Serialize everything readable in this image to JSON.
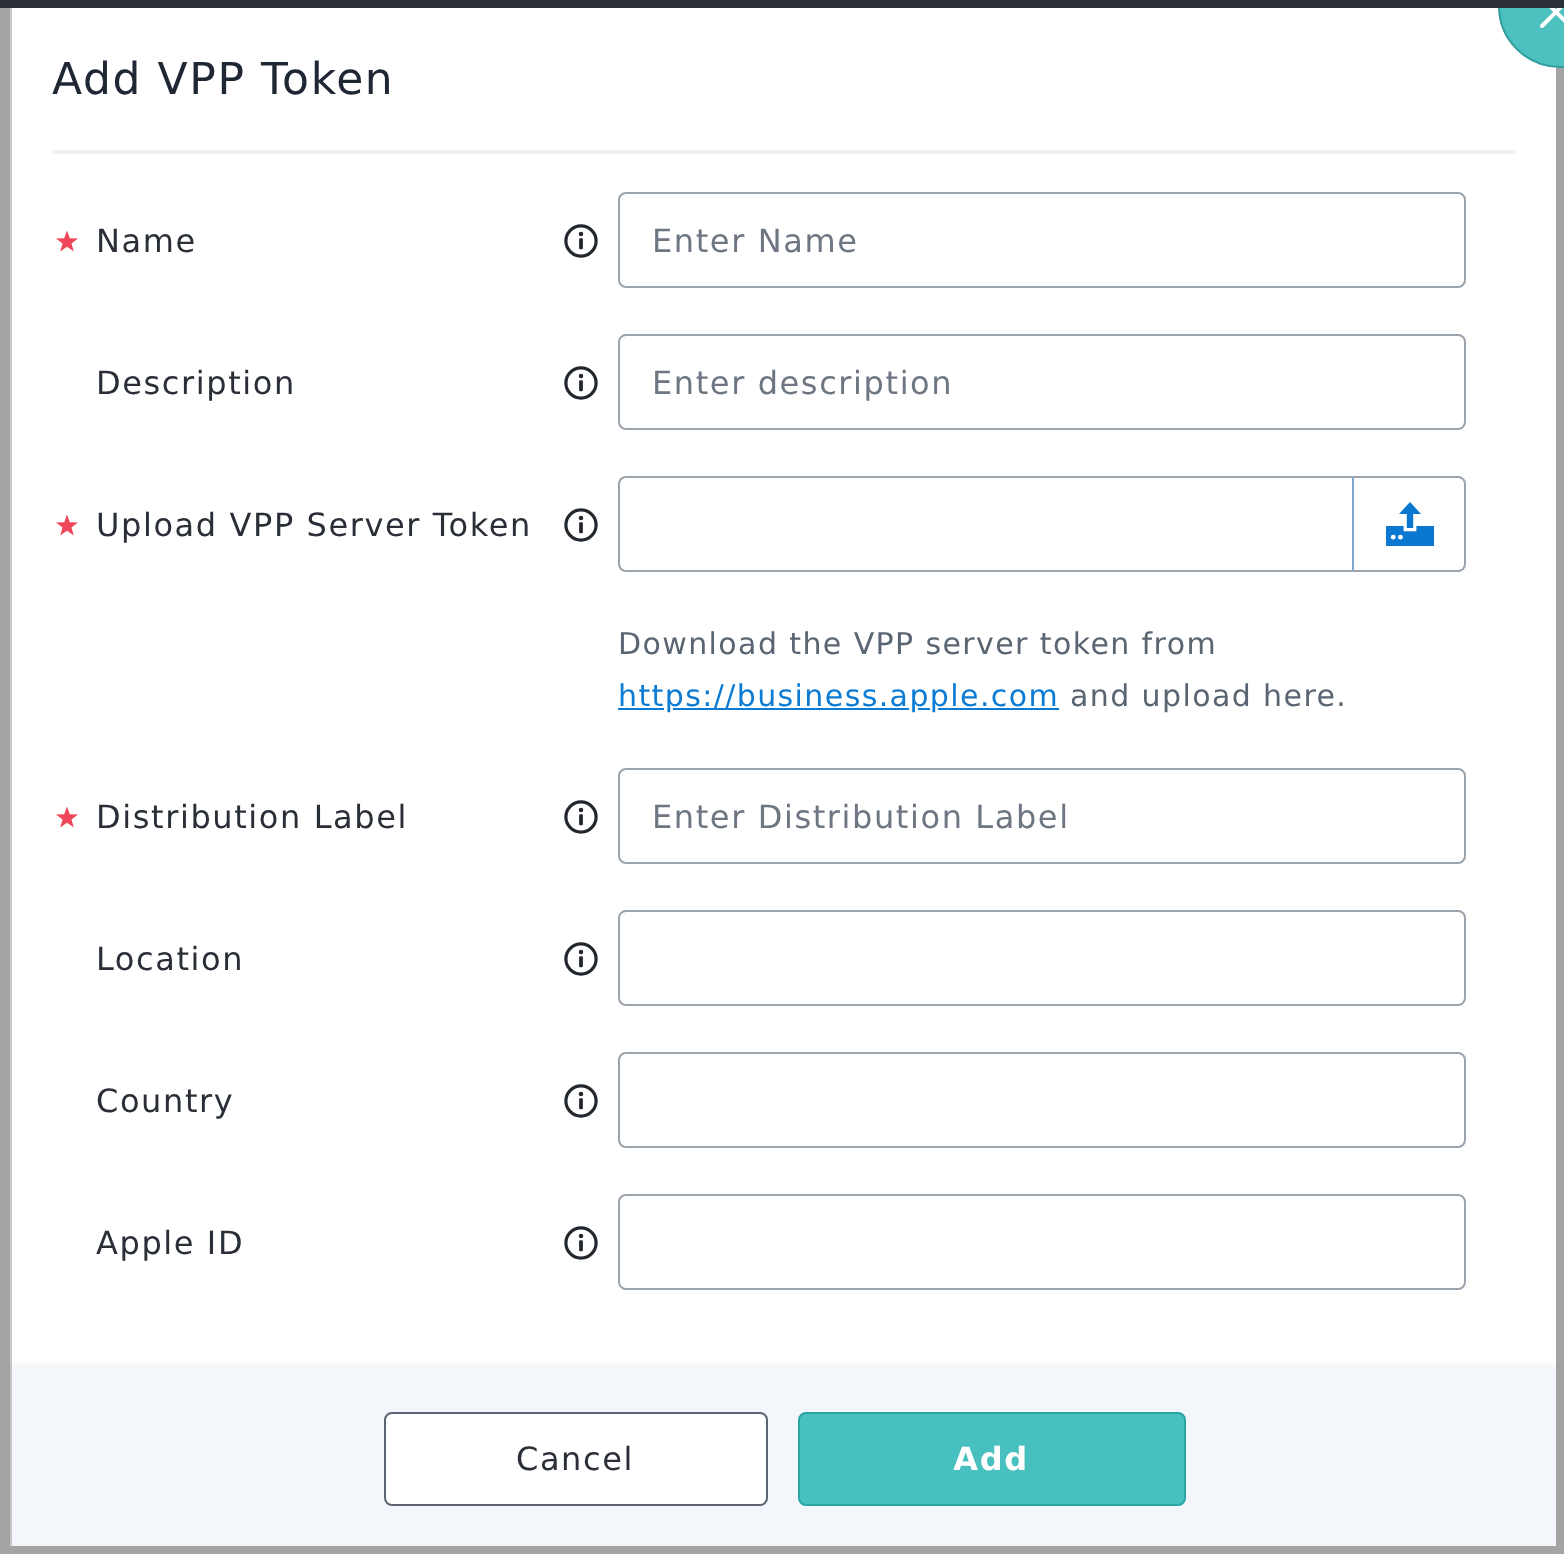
{
  "dialog": {
    "title": "Add VPP Token"
  },
  "fields": [
    {
      "label": "Name",
      "required": true,
      "kind": "text",
      "placeholder": "Enter Name"
    },
    {
      "label": "Description",
      "required": false,
      "kind": "text",
      "placeholder": "Enter description"
    },
    {
      "label": "Upload VPP Server Token",
      "required": true,
      "kind": "file",
      "help": {
        "text_before": "Download the VPP server token from",
        "link": "https://business.apple.com",
        "text_after": "and upload here."
      }
    },
    {
      "label": "Distribution Label",
      "required": true,
      "kind": "text",
      "placeholder": "Enter Distribution Label"
    },
    {
      "label": "Location",
      "required": false,
      "kind": "text"
    },
    {
      "label": "Country",
      "required": false,
      "kind": "text"
    },
    {
      "label": "Apple ID",
      "required": false,
      "kind": "text"
    }
  ],
  "buttons": [
    {
      "label": "Cancel",
      "kind": "secondary"
    },
    {
      "label": "Add",
      "kind": "primary"
    }
  ]
}
